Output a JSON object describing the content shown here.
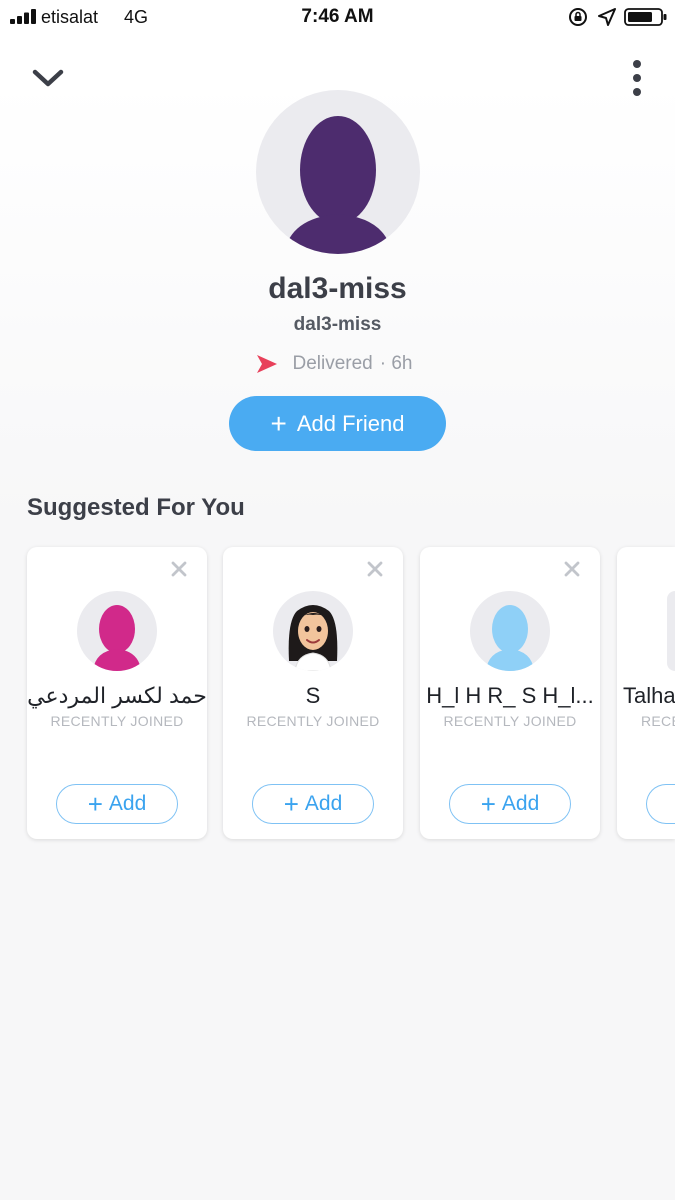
{
  "status_bar": {
    "carrier": "etisalat",
    "network": "4G",
    "time": "7:46 AM"
  },
  "profile": {
    "display_name": "dal3-miss",
    "username": "dal3-miss",
    "status": "Delivered",
    "status_time": "· 6h",
    "add_friend_label": "Add Friend",
    "avatar_color": "#4d2c6e"
  },
  "suggested": {
    "title": "Suggested For You",
    "cards": [
      {
        "name": "حمد لكسر المردعي",
        "subtitle": "RECENTLY JOINED",
        "add_label": "Add",
        "avatar_color": "#d1298a"
      },
      {
        "name": "S",
        "subtitle": "RECENTLY JOINED",
        "add_label": "Add",
        "avatar": "bitmoji-avatar"
      },
      {
        "name": "H_l H R_ S H_l...",
        "subtitle": "RECENTLY JOINED",
        "add_label": "Add",
        "avatar_color": "#8fd0f7"
      },
      {
        "name": "Talha",
        "subtitle": "RECE",
        "add_label": ""
      }
    ]
  },
  "colors": {
    "accent": "#4aabf2",
    "delivered_arrow": "#e8405a"
  }
}
